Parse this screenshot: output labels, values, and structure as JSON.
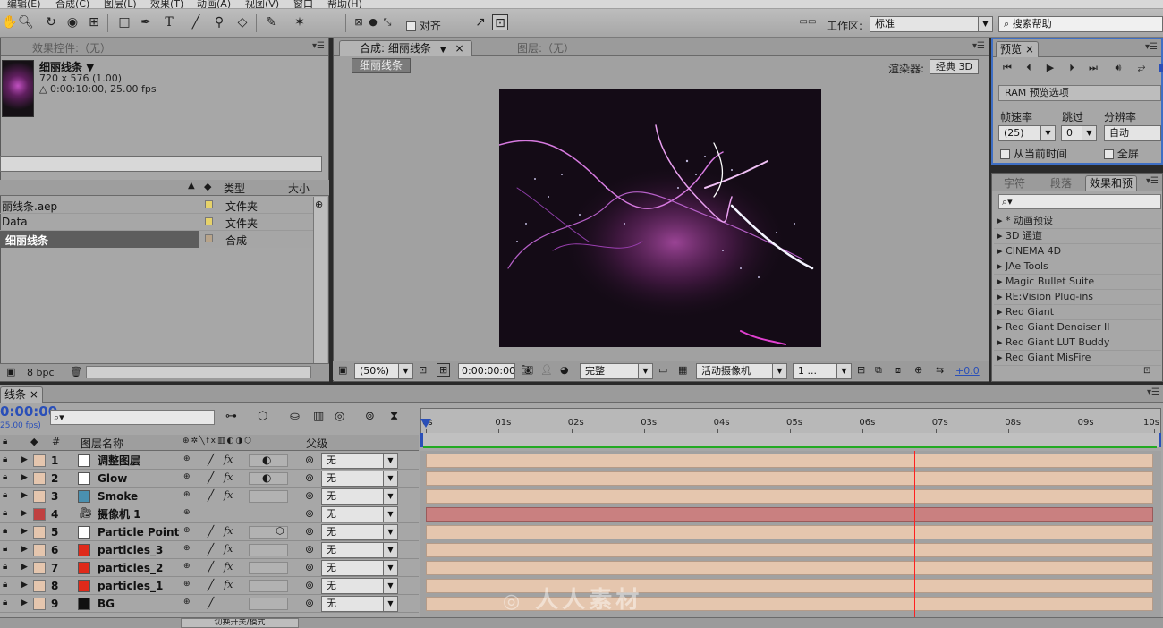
{
  "menu": [
    "编辑(E)",
    "合成(C)",
    "图层(L)",
    "效果(T)",
    "动画(A)",
    "视图(V)",
    "窗口",
    "帮助(H)"
  ],
  "toolbar": {
    "snap_label": "对齐",
    "workspace_label": "工作区:",
    "workspace_value": "标准",
    "search_placeholder": "搜索帮助"
  },
  "project_panel": {
    "tab": "效果控件:（无）",
    "item_name": "细丽线条 ▼",
    "item_size": "720 x 576 (1.00)",
    "item_duration": "△ 0:00:10:00, 25.00 fps",
    "col_type": "类型",
    "col_size": "大小",
    "rows": [
      {
        "name": "丽线条.aep",
        "type": "文件夹",
        "color": "#e6d26a"
      },
      {
        "name": "Data",
        "type": "文件夹",
        "color": "#e6d26a"
      },
      {
        "name": "细丽线条",
        "type": "合成",
        "color": "#b8a48a"
      }
    ],
    "bpc": "8 bpc"
  },
  "comp_panel": {
    "tab_comp": "合成: 细丽线条",
    "tab_layer": "图层:（无）",
    "comp_chip": "细丽线条",
    "renderer_label": "渲染器:",
    "renderer_value": "经典 3D",
    "zoom": "(50%)",
    "timecode": "0:00:00:00",
    "quality": "完整",
    "camera": "活动摄像机",
    "views": "1 ...",
    "exposure": "+0.0"
  },
  "preview_panel": {
    "tab": "预览",
    "ram_options": "RAM 预览选项",
    "frame_rate_label": "帧速率",
    "skip_label": "跳过",
    "resolution_label": "分辨率",
    "frame_rate_value": "(25)",
    "skip_value": "0",
    "resolution_value": "自动",
    "from_current": "从当前时间",
    "fullscreen": "全屏"
  },
  "effects_panel": {
    "tabs": [
      "字符",
      "段落",
      "效果和预"
    ],
    "items": [
      "* 动画预设",
      "3D 通道",
      "CINEMA 4D",
      "JAe Tools",
      "Magic Bullet Suite",
      "RE:Vision Plug-ins",
      "Red Giant",
      "Red Giant Denoiser II",
      "Red Giant LUT Buddy",
      "Red Giant MisFire"
    ]
  },
  "timeline": {
    "tab": "线条",
    "timecode": "0:00:00",
    "fps": "25.00 fps)",
    "col_num": "#",
    "col_name": "图层名称",
    "col_parent": "父级",
    "ruler": [
      "0s",
      "01s",
      "02s",
      "03s",
      "04s",
      "05s",
      "06s",
      "07s",
      "08s",
      "09s",
      "10s"
    ],
    "layers": [
      {
        "num": "1",
        "name": "调整图层",
        "color": "#ffffff",
        "parent": "无"
      },
      {
        "num": "2",
        "name": "Glow",
        "color": "#ffffff",
        "parent": "无"
      },
      {
        "num": "3",
        "name": "Smoke",
        "color": "#4a90b0",
        "parent": "无"
      },
      {
        "num": "4",
        "name": "摄像机 1",
        "color": "#c04040",
        "parent": "无"
      },
      {
        "num": "5",
        "name": "Particle Point",
        "color": "#ffffff",
        "parent": "无"
      },
      {
        "num": "6",
        "name": "particles_3",
        "color": "#e02a1a",
        "parent": "无"
      },
      {
        "num": "7",
        "name": "particles_2",
        "color": "#e02a1a",
        "parent": "无"
      },
      {
        "num": "8",
        "name": "particles_1",
        "color": "#e02a1a",
        "parent": "无"
      },
      {
        "num": "9",
        "name": "BG",
        "color": "#111111",
        "parent": "无"
      }
    ],
    "toggle_label": "切换开关/模式"
  },
  "watermark": "人人素材"
}
